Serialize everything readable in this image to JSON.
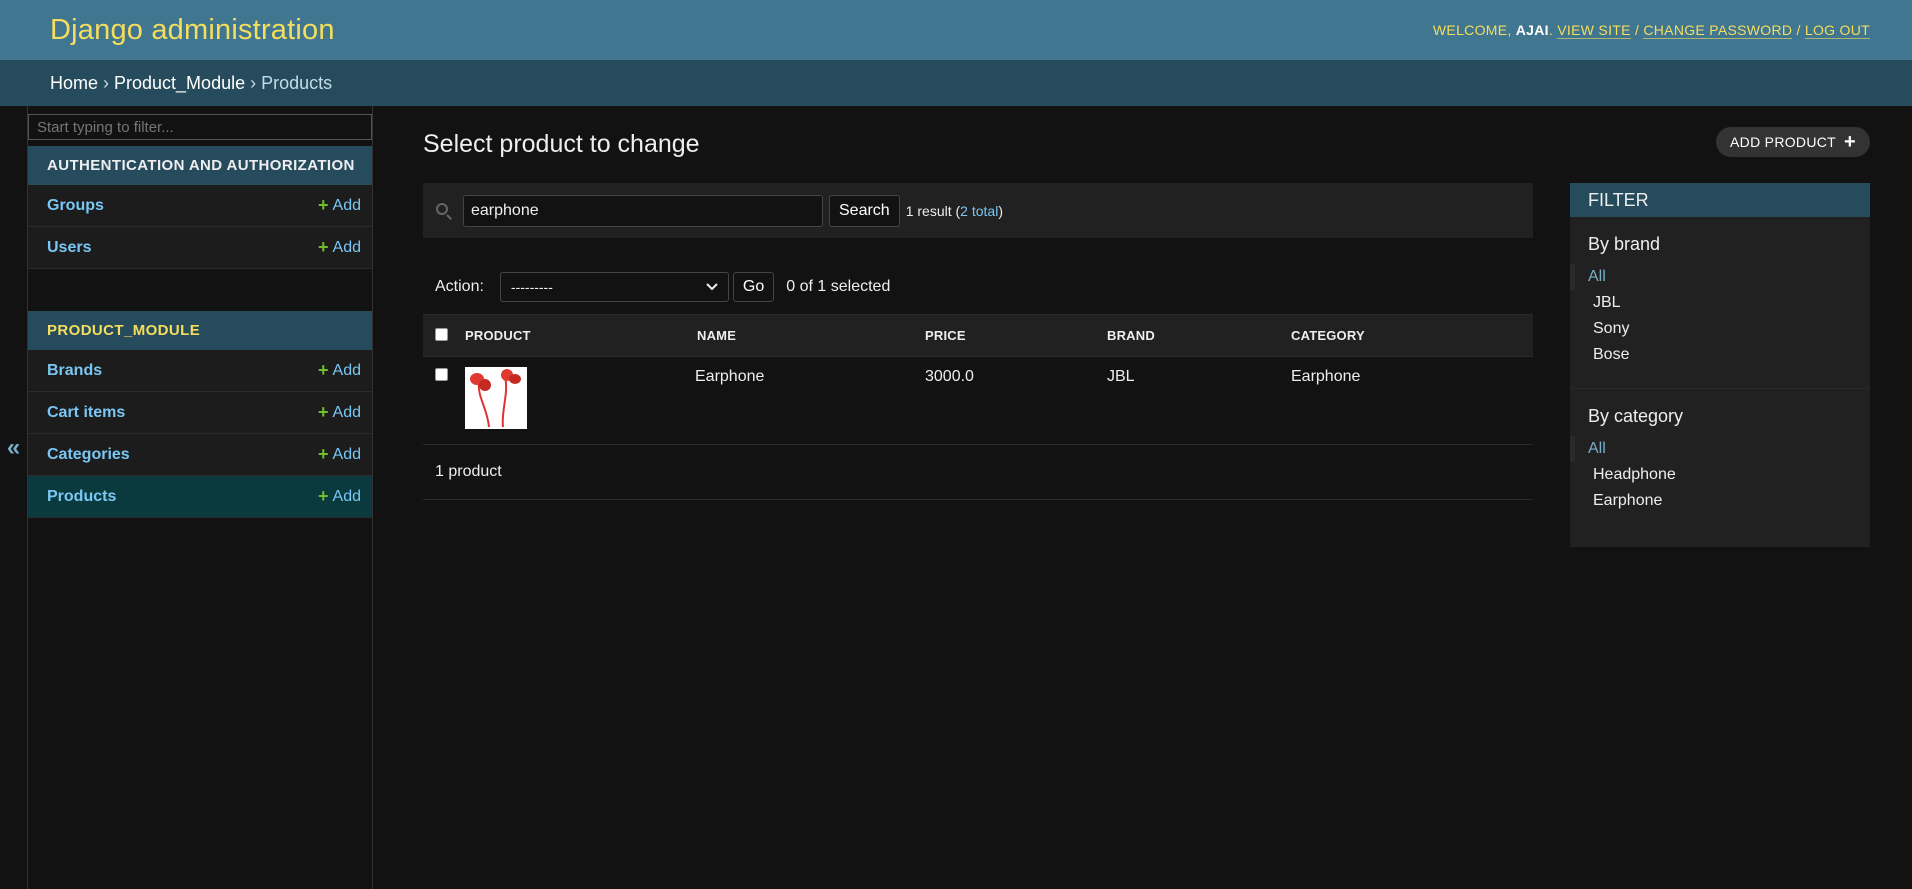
{
  "header": {
    "site_name": "Django administration",
    "welcome": "Welcome,",
    "username": "ajai",
    "view_site": "View site",
    "change_password": "Change password",
    "log_out": "Log out"
  },
  "breadcrumbs": [
    "Home",
    "Product_Module",
    "Products"
  ],
  "nav": {
    "filter_placeholder": "Start typing to filter...",
    "toggle_label": "«",
    "add_label": "Add",
    "modules": [
      {
        "caption": "Authentication and Authorization",
        "models": [
          "Groups",
          "Users"
        ]
      },
      {
        "caption": "Product_Module",
        "models": [
          "Brands",
          "Cart items",
          "Categories",
          "Products"
        ]
      }
    ]
  },
  "content": {
    "title": "Select product to change",
    "add_button": "Add product",
    "search": {
      "value": "earphone",
      "button": "Search",
      "result_prefix": "1 result (",
      "total_link": "2 total",
      "result_suffix": ")"
    },
    "actions": {
      "label": "Action:",
      "selected_option": "---------",
      "go": "Go",
      "counter": "0 of 1 selected"
    },
    "table": {
      "headers": [
        "Product",
        "Name",
        "Price",
        "Brand",
        "Category"
      ],
      "rows": [
        {
          "name": "Earphone",
          "price": "3000.0",
          "brand": "JBL",
          "category": "Earphone"
        }
      ]
    },
    "paginator": "1 product"
  },
  "filter": {
    "title": "Filter",
    "sections": [
      {
        "title": "By brand",
        "options": [
          "All",
          "JBL",
          "Sony",
          "Bose"
        ],
        "selected": "All"
      },
      {
        "title": "By category",
        "options": [
          "All",
          "Headphone",
          "Earphone"
        ],
        "selected": "All"
      }
    ]
  },
  "colors": {
    "header": "#417690",
    "breadcrumbs": "#264b5d",
    "accent_yellow": "#f5dd5d",
    "link": "#79c7f2",
    "add_green": "#70bf2b"
  }
}
